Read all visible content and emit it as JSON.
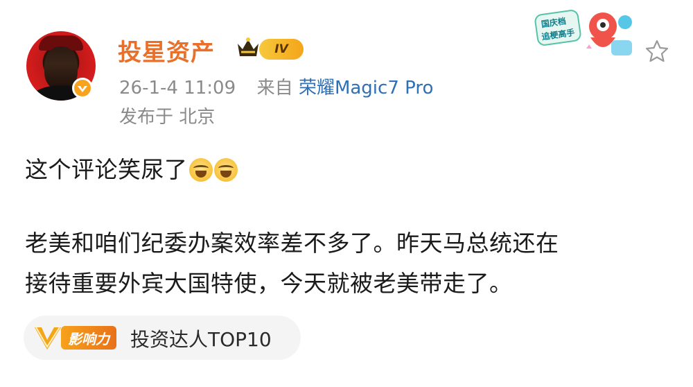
{
  "post": {
    "username": "投星资产",
    "level_badge": "IV",
    "meta": {
      "datetime": "26-1-4 11:09",
      "source_prefix": "来自",
      "device": "荣耀Magic7 Pro"
    },
    "location": "发布于 北京",
    "lines": [
      "这个评论笑尿了",
      "老美和咱们纪委办案效率差不多了。昨天马总统还在",
      "接待重要外宾大国特使，今天就被老美带走了。"
    ],
    "line1_emojis": [
      "laughing-crying-emoji",
      "laughing-crying-emoji"
    ],
    "influence_tag": {
      "v_label": "V",
      "label": "影响力",
      "title": "投资达人TOP10"
    },
    "decoration_text": [
      "国庆档",
      "追梗高手"
    ]
  },
  "colors": {
    "username": "#e8702a",
    "device_link": "#2f6fb6",
    "meta_gray": "#8a8a8a",
    "badge_gold": "#f4a51a"
  },
  "icons": {
    "avatar": "profile-photo",
    "verified": "verified-badge-icon",
    "crown": "crown-icon",
    "favorite": "star-outline-icon"
  }
}
